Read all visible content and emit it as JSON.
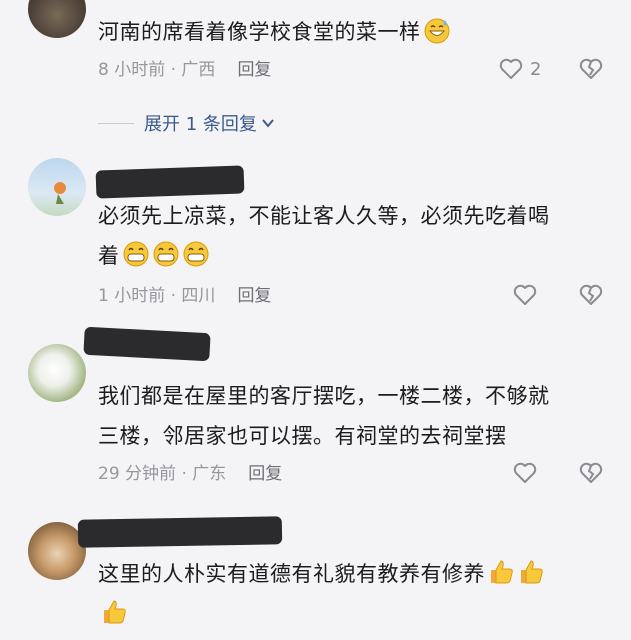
{
  "comments": [
    {
      "text": "河南的席看着像学校食堂的菜一样",
      "emojis": [
        "sweat-smile"
      ],
      "time": "8 小时前 · 广西",
      "reply_label": "回复",
      "like_count": "2",
      "expand_replies": "展开 1 条回复"
    },
    {
      "text_line1": "必须先上凉菜，不能让客人久等，必须先吃着喝",
      "text_line2": "着",
      "emojis": [
        "grin",
        "grin",
        "grin"
      ],
      "time": "1 小时前 · 四川",
      "reply_label": "回复",
      "like_count": ""
    },
    {
      "text_line1": "我们都是在屋里的客厅摆吃，一楼二楼，不够就",
      "text_line2": "三楼，邻居家也可以摆。有祠堂的去祠堂摆",
      "time": "29 分钟前 · 广东",
      "reply_label": "回复",
      "like_count": ""
    },
    {
      "text_line1": "这里的人朴实有道德有礼貌有教养有修养",
      "emojis_line1": [
        "thumbs-up",
        "thumbs-up"
      ],
      "emojis_line2": [
        "thumbs-up"
      ]
    }
  ],
  "colors": {
    "background": "#f4f4f6",
    "text": "#1c1c20",
    "meta": "#96969c",
    "link": "#3a5a8a",
    "redaction": "#2b2b2e"
  }
}
